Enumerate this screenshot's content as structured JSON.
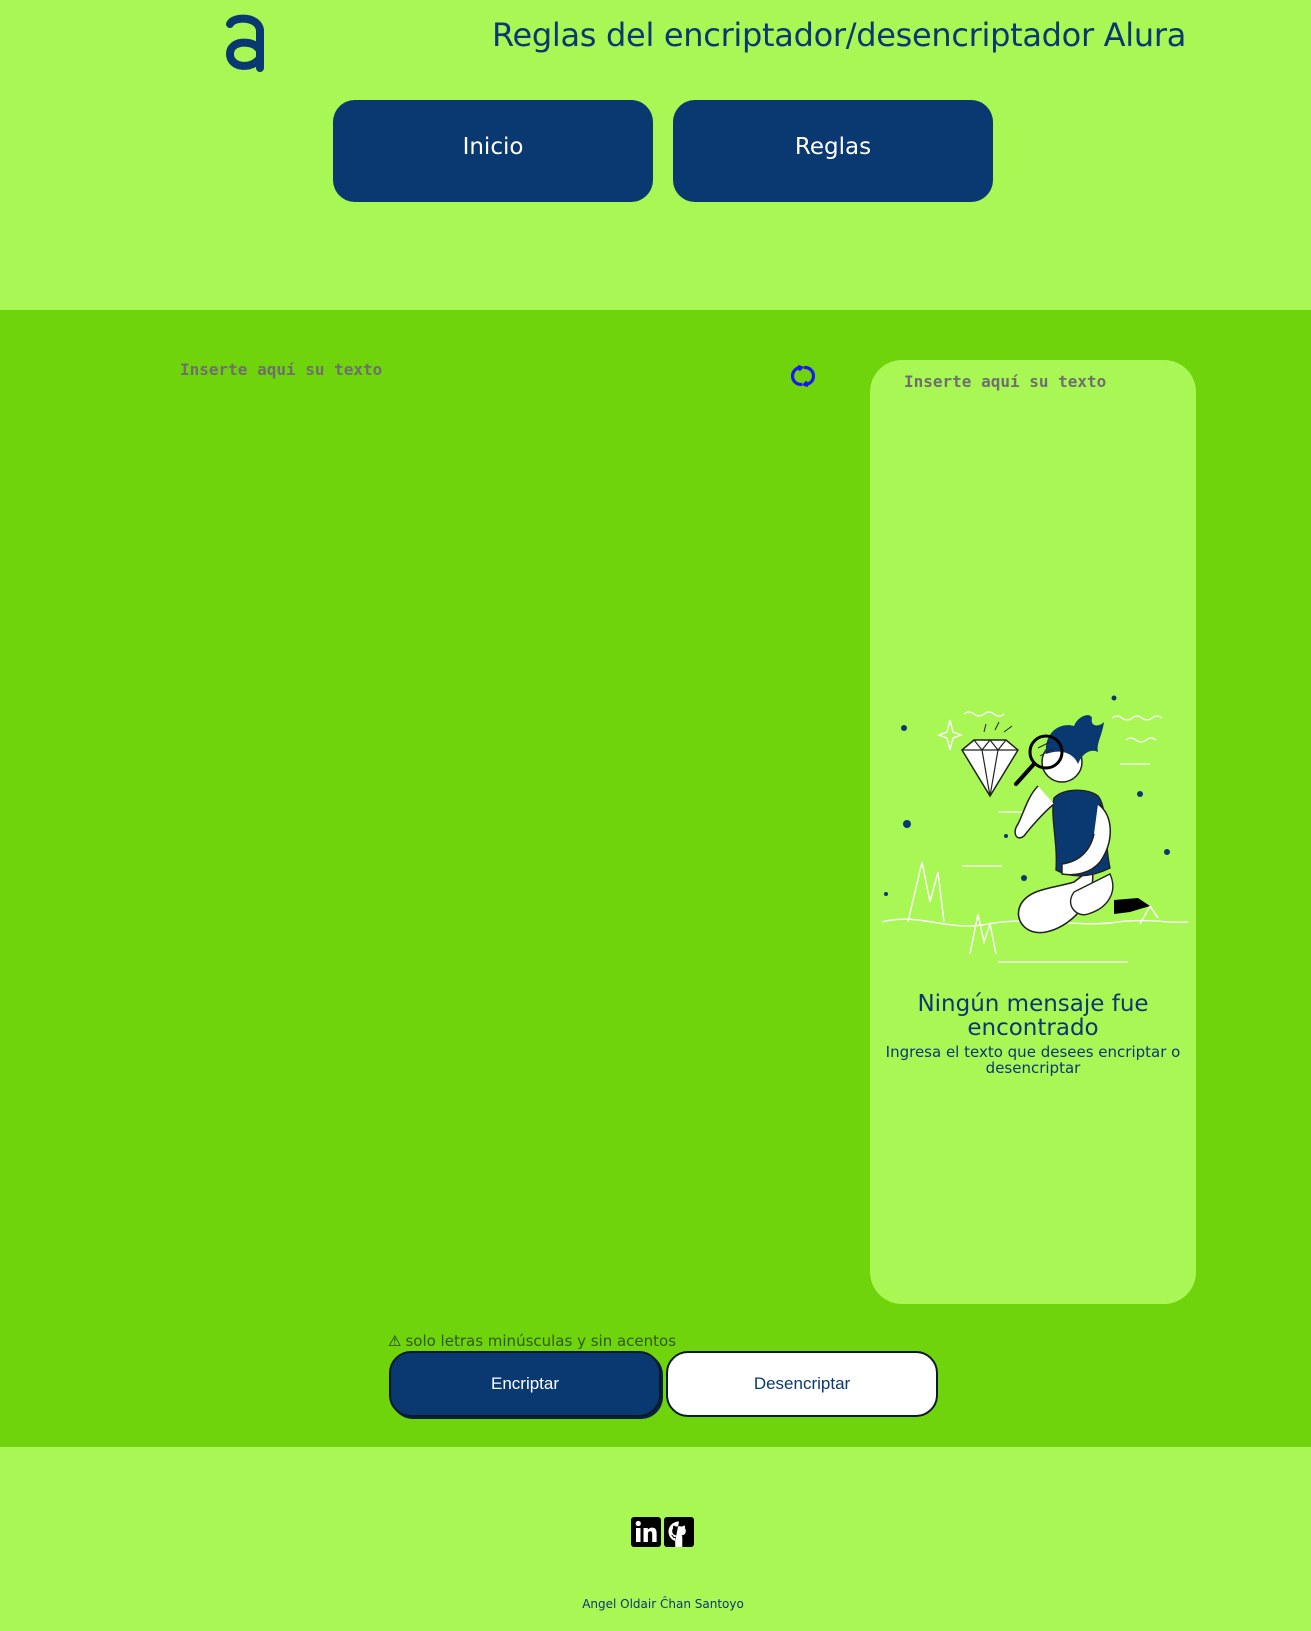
{
  "header": {
    "logo_alt": "Alura",
    "title": "Reglas del encriptador/desencriptador Alura",
    "nav": {
      "inicio_label": "Inicio",
      "reglas_label": "Reglas"
    }
  },
  "main": {
    "input_placeholder": "Inserte aquí su texto",
    "output": {
      "placeholder": "Inserte aquí su texto",
      "empty_title": "Ningún mensaje fue encontrado",
      "empty_subtitle": "Ingresa el texto que desees encriptar o desencriptar"
    },
    "warning_icon": "⚠",
    "warning_text": "solo letras minúsculas y sin acentos",
    "encrypt_label": "Encriptar",
    "decrypt_label": "Desencriptar"
  },
  "footer": {
    "credits": "Angel Oldair Ĉhan Santoyo"
  },
  "colors": {
    "header_bg": "#a9f755",
    "main_bg": "#6fd40b",
    "accent": "#0a3871",
    "refresh_icon": "#1a1af0"
  },
  "icons": {
    "logo": "alura-logo",
    "refresh": "refresh-icon",
    "linkedin": "linkedin-icon",
    "github": "github-icon"
  }
}
